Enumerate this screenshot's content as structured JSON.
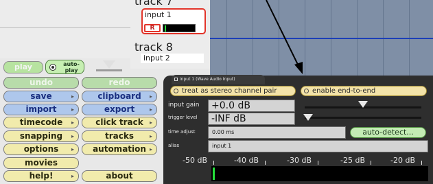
{
  "tracks": [
    {
      "name": "track 7",
      "input": "input 1",
      "rec": "R"
    },
    {
      "name": "track 8",
      "input": "input 2"
    }
  ],
  "transport": {
    "play": "play",
    "auto_play": "auto-\nplay"
  },
  "buttons": {
    "undo": "undo",
    "redo": "redo",
    "save": "save",
    "clipboard": "clipboard",
    "import": "import",
    "export": "export",
    "timecode": "timecode",
    "click_track": "click track",
    "snapping": "snapping",
    "tracks": "tracks",
    "options": "options",
    "automation": "automation",
    "movies": "movies",
    "help": "help!",
    "about": "about"
  },
  "panel": {
    "tab": "input 1 (Wave Audio Input)",
    "stereo": "treat as stereo channel pair",
    "end_to_end": "enable end-to-end",
    "input_gain_label": "input gain",
    "input_gain_value": "+0.0 dB",
    "trigger_label": "trigger level",
    "trigger_value": "-INF dB",
    "time_adjust_label": "time adjust",
    "time_adjust_value": "0.00 ms",
    "alias_label": "alias",
    "alias_value": "input 1",
    "auto_detect": "auto-detect...",
    "db_labels": [
      "-50 dB",
      "-40 dB",
      "-30 dB",
      "-25 dB",
      "-20 dB"
    ]
  },
  "colors": {
    "record_red": "#e2342a",
    "meter_green": "#25e03b",
    "selection_blue": "#1c3fb8"
  }
}
